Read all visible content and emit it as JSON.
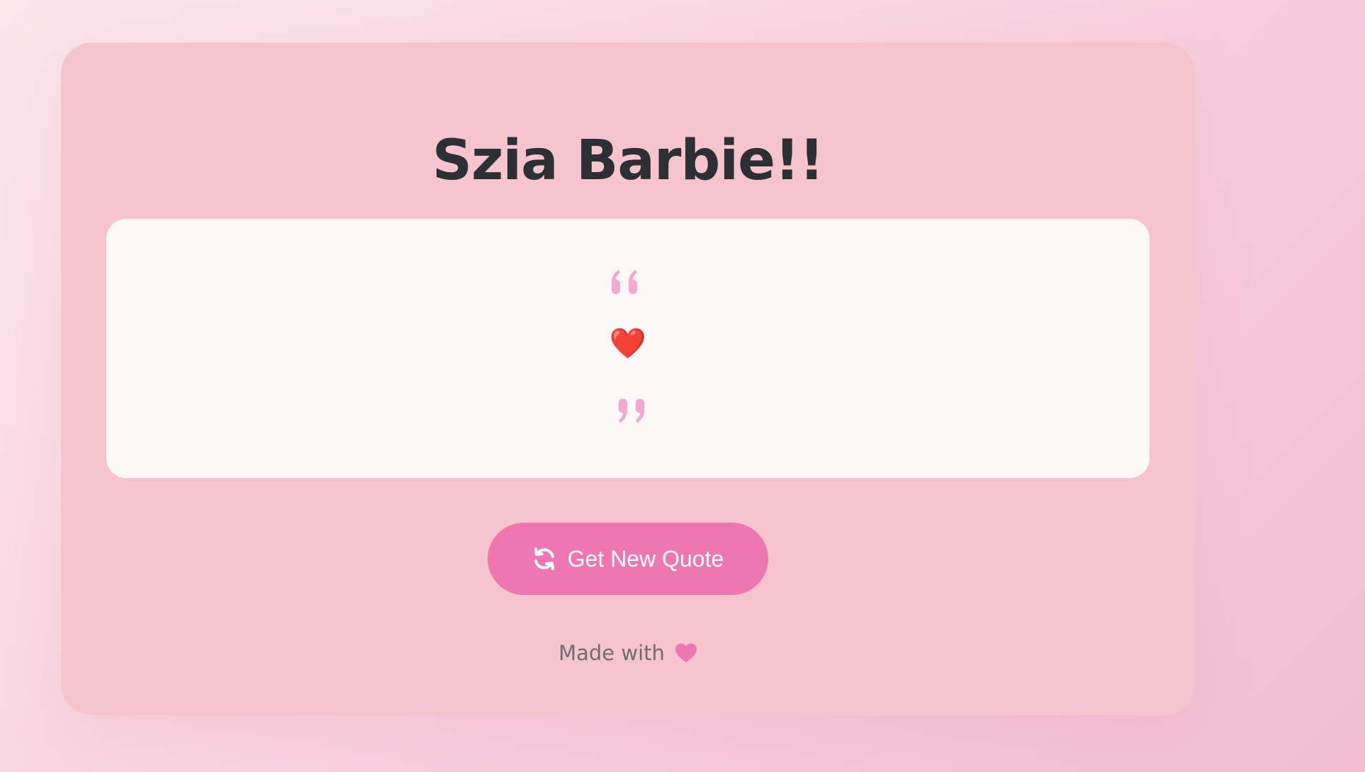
{
  "page": {
    "title": "Szia Barbie!!"
  },
  "quote": {
    "text": "❤️",
    "open_icon": "quote-left-icon",
    "close_icon": "quote-right-icon"
  },
  "button": {
    "label": "Get New Quote",
    "icon": "sync-icon"
  },
  "footer": {
    "label": "Made with",
    "icon": "heart-icon"
  },
  "colors": {
    "background": "#f8d6e2",
    "card": "#f5c4cd",
    "quote_box": "#fdf8f8",
    "accent": "#ee77b1",
    "quote_mark": "#f2a9cd",
    "title": "#2c2f33",
    "footer_text": "#6d6d72"
  }
}
